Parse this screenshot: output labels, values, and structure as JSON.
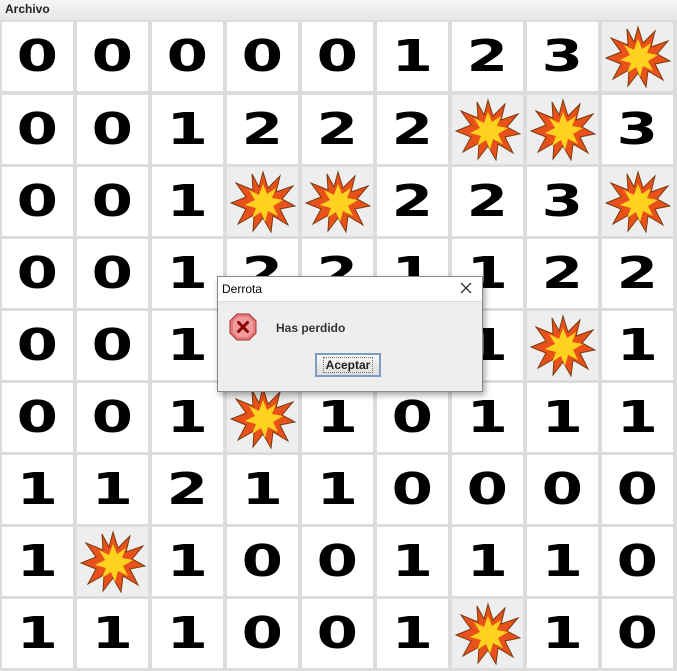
{
  "menubar": {
    "items": [
      "Archivo"
    ]
  },
  "board": {
    "rows": [
      [
        "0",
        "0",
        "0",
        "0",
        "0",
        "1",
        "2",
        "3",
        "*"
      ],
      [
        "0",
        "0",
        "1",
        "2",
        "2",
        "2",
        "*",
        "*",
        "3"
      ],
      [
        "0",
        "0",
        "1",
        "*",
        "*",
        "2",
        "2",
        "3",
        "*"
      ],
      [
        "0",
        "0",
        "1",
        "2",
        "2",
        "1",
        "1",
        "2",
        "2"
      ],
      [
        "0",
        "0",
        "1",
        "",
        "",
        "",
        "1",
        "*",
        "1"
      ],
      [
        "0",
        "0",
        "1",
        "*",
        "1",
        "0",
        "1",
        "1",
        "1"
      ],
      [
        "1",
        "1",
        "2",
        "1",
        "1",
        "0",
        "0",
        "0",
        "0"
      ],
      [
        "1",
        "*",
        "1",
        "0",
        "0",
        "1",
        "1",
        "1",
        "0"
      ],
      [
        "1",
        "1",
        "1",
        "0",
        "0",
        "1",
        "*",
        "1",
        "0"
      ]
    ],
    "mine_symbol": "*"
  },
  "dialog": {
    "title": "Derrota",
    "message": "Has perdido",
    "button_label": "Aceptar",
    "icon": "error-icon",
    "close_icon": "close-icon"
  },
  "colors": {
    "mine_outer": "#e8511a",
    "mine_inner": "#ffd21f",
    "error_icon_fill": "#e77a7a",
    "error_icon_mark": "#8b0000",
    "button_border": "#7d9cc4"
  }
}
